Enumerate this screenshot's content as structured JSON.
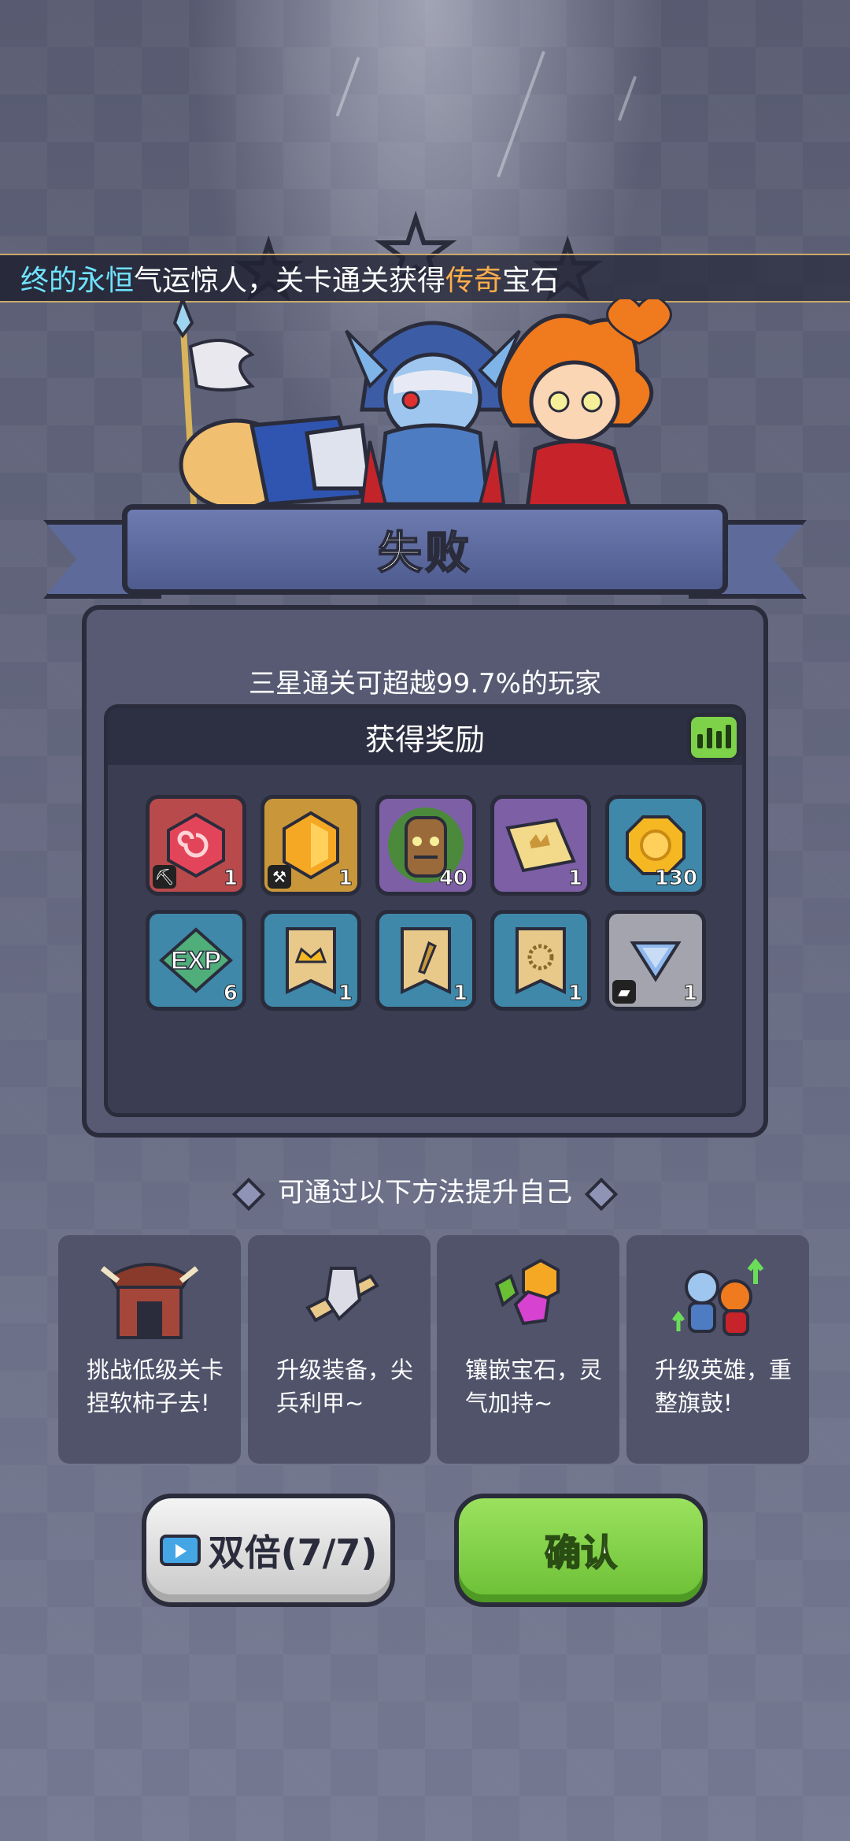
{
  "ticker": {
    "part1": "终的永恒",
    "part2": "气运惊人，关卡通关获得",
    "part3": "传奇",
    "part4": "宝石"
  },
  "result": {
    "title": "失败"
  },
  "panel": {
    "subtitle": "三星通关可超越99.7%的玩家",
    "rewards_title": "获得奖励"
  },
  "rewards": [
    {
      "name": "red-gem-icon",
      "count": "1",
      "rarity": "red"
    },
    {
      "name": "gold-gem-icon",
      "count": "1",
      "rarity": "gold"
    },
    {
      "name": "tree-spirit-icon",
      "count": "40",
      "rarity": "purple"
    },
    {
      "name": "ticket-icon",
      "count": "1",
      "rarity": "purple"
    },
    {
      "name": "gold-coin-icon",
      "count": "130",
      "rarity": "blue"
    },
    {
      "name": "exp-icon",
      "count": "6",
      "rarity": "blue",
      "label": "EXP"
    },
    {
      "name": "crown-scroll-icon",
      "count": "1",
      "rarity": "blue"
    },
    {
      "name": "weapon-scroll-icon",
      "count": "1",
      "rarity": "blue"
    },
    {
      "name": "necklace-scroll-icon",
      "count": "1",
      "rarity": "blue"
    },
    {
      "name": "triangle-gem-icon",
      "count": "1",
      "rarity": "grey"
    }
  ],
  "tips": {
    "title": "可通过以下方法提升自己",
    "items": [
      {
        "name": "tip-challenge-low",
        "text": "挑战低级关卡捏软柿子去!"
      },
      {
        "name": "tip-upgrade-gear",
        "text": "升级装备，尖兵利甲~"
      },
      {
        "name": "tip-inlay-gems",
        "text": "镶嵌宝石，灵气加持~"
      },
      {
        "name": "tip-upgrade-hero",
        "text": "升级英雄，重整旗鼓!"
      }
    ]
  },
  "buttons": {
    "double": "双倍(7/7)",
    "confirm": "确认"
  }
}
